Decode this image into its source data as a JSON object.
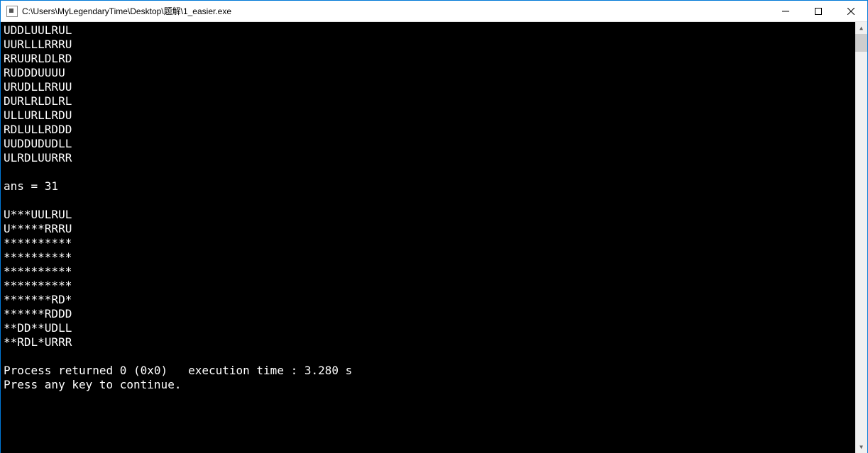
{
  "window": {
    "title": "C:\\Users\\MyLegendaryTime\\Desktop\\题解\\1_easier.exe"
  },
  "console": {
    "lines": [
      "UDDLUULRUL",
      "UURLLLRRRU",
      "RRUURLDLRD",
      "RUDDDUUUU",
      "URUDLLRRUU",
      "DURLRLDLRL",
      "ULLURLLRDU",
      "RDLULLRDDD",
      "UUDDUDUDLL",
      "ULRDLUURRR",
      "",
      "ans = 31",
      "",
      "U***UULRUL",
      "U*****RRRU",
      "**********",
      "**********",
      "**********",
      "**********",
      "*******RD*",
      "******RDDD",
      "**DD**UDLL",
      "**RDL*URRR",
      "",
      "Process returned 0 (0x0)   execution time : 3.280 s",
      "Press any key to continue."
    ]
  }
}
